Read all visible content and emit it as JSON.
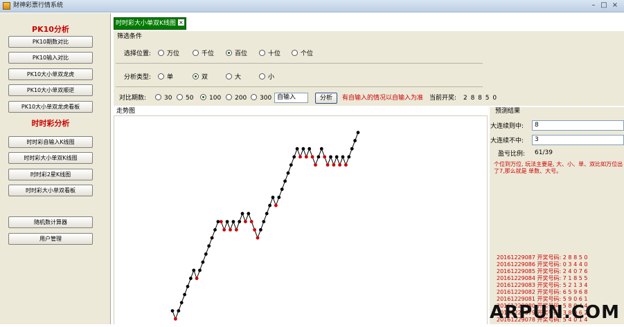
{
  "window": {
    "title": "财神彩票行情系统",
    "controls": {
      "minimize": "–",
      "maximize": "□",
      "close": "×"
    }
  },
  "sidebar": {
    "pk10_heading": "PK10分析",
    "pk10_buttons": [
      "PK10期数对比",
      "PK10输入对比",
      "PK10大小单双龙虎",
      "PK10大小单双顺逆",
      "PK10大小单双龙虎看板"
    ],
    "ssc_heading": "时时彩分析",
    "ssc_buttons": [
      "时时彩自输入K线图",
      "时时彩大小单双K线图",
      "时时彩2星K线图",
      "时时彩大小单双看板"
    ],
    "tool_buttons": [
      "随机数计算器",
      "用户管理"
    ]
  },
  "tab": {
    "label": "时时彩大小单双K线图",
    "close": "×"
  },
  "filter": {
    "title": "筛选条件",
    "position_label": "选择位置:",
    "positions": [
      "万位",
      "千位",
      "百位",
      "十位",
      "个位"
    ],
    "position_selected": 2,
    "type_label": "分析类型:",
    "types": [
      "单",
      "双",
      "大",
      "小"
    ],
    "type_selected": 1,
    "periods_label": "对比期数:",
    "periods": [
      "30",
      "50",
      "100",
      "200",
      "300"
    ],
    "period_selected": 2,
    "custom_input": "自输入",
    "analyze_button": "分析",
    "hint": "有自输入的情况以自输入为准",
    "current_draw_label": "当前开奖:",
    "current_draw": "2 8 8 5 0"
  },
  "trend": {
    "label": "走势图"
  },
  "prediction": {
    "title": "预测结果",
    "max_consecutive_hit_label": "大连续则中:",
    "max_consecutive_hit": "8",
    "max_consecutive_miss_label": "大连续不中:",
    "max_consecutive_miss": "3",
    "ratio_label": "盈亏比例:",
    "ratio": "61/39",
    "note": "个位到万位,  玩法主要是, 大、小、单、双比如万位出了7,那么就是 单数、大号。",
    "results": [
      {
        "issue": "20161229087",
        "label": "开奖号码:",
        "number": "2 8 8 5 0"
      },
      {
        "issue": "20161229086",
        "label": "开奖号码:",
        "number": "0 3 4 4 0"
      },
      {
        "issue": "20161229085",
        "label": "开奖号码:",
        "number": "2 4 0 7 6"
      },
      {
        "issue": "20161229084",
        "label": "开奖号码:",
        "number": "7 1 8 5 5"
      },
      {
        "issue": "20161229083",
        "label": "开奖号码:",
        "number": "5 2 1 3 4"
      },
      {
        "issue": "20161229082",
        "label": "开奖号码:",
        "number": "6 5 9 6 8"
      },
      {
        "issue": "20161229081",
        "label": "开奖号码:",
        "number": "5 9 0 6 1"
      },
      {
        "issue": "20161229080",
        "label": "开奖号码:",
        "number": "5 8 0 4 4"
      },
      {
        "issue": "20161229079",
        "label": "开奖号码:",
        "number": "3 8 9 6 2"
      },
      {
        "issue": "20161229078",
        "label": "开奖号码:",
        "number": "5 4 0 1 4"
      }
    ]
  },
  "watermark": "ARPUN.COM",
  "chart_data": {
    "type": "line",
    "colors": {
      "line": "#000000",
      "hit": "#000000",
      "miss": "#cc0000"
    },
    "values": [
      0,
      -1,
      0,
      1,
      2,
      3,
      4,
      5,
      4,
      5,
      6,
      7,
      8,
      9,
      10,
      11,
      11,
      10,
      11,
      10,
      11,
      10,
      11,
      12,
      11,
      12,
      11,
      10,
      9,
      10,
      11,
      12,
      13,
      14,
      13,
      14,
      15,
      16,
      17,
      18,
      19,
      20,
      19,
      20,
      19,
      20,
      19,
      18,
      19,
      20,
      19,
      18,
      19,
      18,
      19,
      18,
      19,
      18,
      19,
      20,
      21,
      22
    ],
    "ylim": [
      -2,
      23
    ]
  }
}
